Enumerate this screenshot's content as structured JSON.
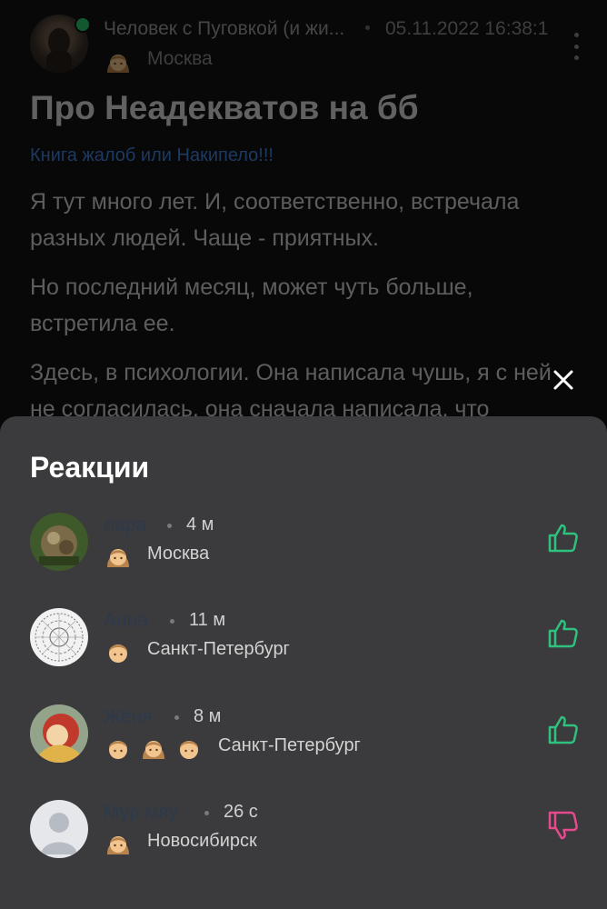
{
  "post": {
    "author": "Человек с Пуговкой (и жи...",
    "date": "05.11.2022 16:38:1",
    "city": "Москва",
    "title": "Про Неадекватов на бб",
    "category": "Книга жалоб или Накипело!!!",
    "paragraphs": [
      "Я тут много лет. И, соответственно, встречала разных людей. Чаще - приятных.",
      "Но последний месяц, может чуть больше, встретила ее.",
      "Здесь, в психологии. Она написала чушь, я с ней не согласилась, она сначала написала, что"
    ],
    "author_emoji_icon": "woman-emoji-icon"
  },
  "sheet": {
    "title": "Реакции",
    "close_icon": "close-icon",
    "reactions": [
      {
        "name": "лара",
        "time": "4 м",
        "city": "Москва",
        "emojis": [
          "woman"
        ],
        "reaction": "like"
      },
      {
        "name": "Анна",
        "time": "11 м",
        "city": "Санкт-Петербург",
        "emojis": [
          "man"
        ],
        "reaction": "like"
      },
      {
        "name": "Женя",
        "time": "8 м",
        "city": "Санкт-Петербург",
        "emojis": [
          "man",
          "woman",
          "man"
        ],
        "reaction": "like"
      },
      {
        "name": "Мур мяу",
        "time": "26 с",
        "city": "Новосибирск",
        "emojis": [
          "woman"
        ],
        "reaction": "dislike"
      }
    ]
  },
  "colors": {
    "like": "#2ec27e",
    "dislike": "#e64a8c",
    "sheet_bg": "#3b3b3d",
    "online": "#26c26a"
  }
}
